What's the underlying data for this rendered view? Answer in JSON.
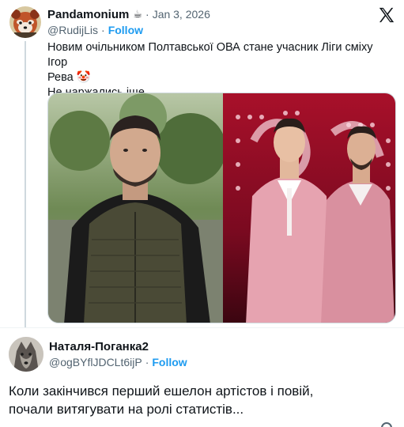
{
  "tweet": {
    "author": {
      "name": "Pandamonium",
      "emoji": "☕",
      "handle": "@RudijLis",
      "follow_label": "Follow",
      "avatar_icon": "red-panda-avatar"
    },
    "date": "Jan 3, 2026",
    "separator": "·",
    "text_line1": "Новим очільником Полтавської ОВА стане учасник Ліги сміху Ігор",
    "text_line2": "Рева 🤡",
    "text_line3": "Не наржались іще",
    "platform_icon": "x-logo-icon"
  },
  "reply": {
    "author": {
      "name": "Наталя-Поганка2",
      "handle": "@ogBYflJDCLt6ijP",
      "follow_label": "Follow",
      "avatar_icon": "wolf-avatar"
    },
    "separator": "·",
    "text_line1": "Коли закінчився перший ешелон артістов і повій,",
    "text_line2": "почали витягувати на ролі статистів..."
  },
  "colors": {
    "text": "#0f1419",
    "secondary": "#536471",
    "accent": "#1d9bf0",
    "border": "#cfd9de"
  }
}
